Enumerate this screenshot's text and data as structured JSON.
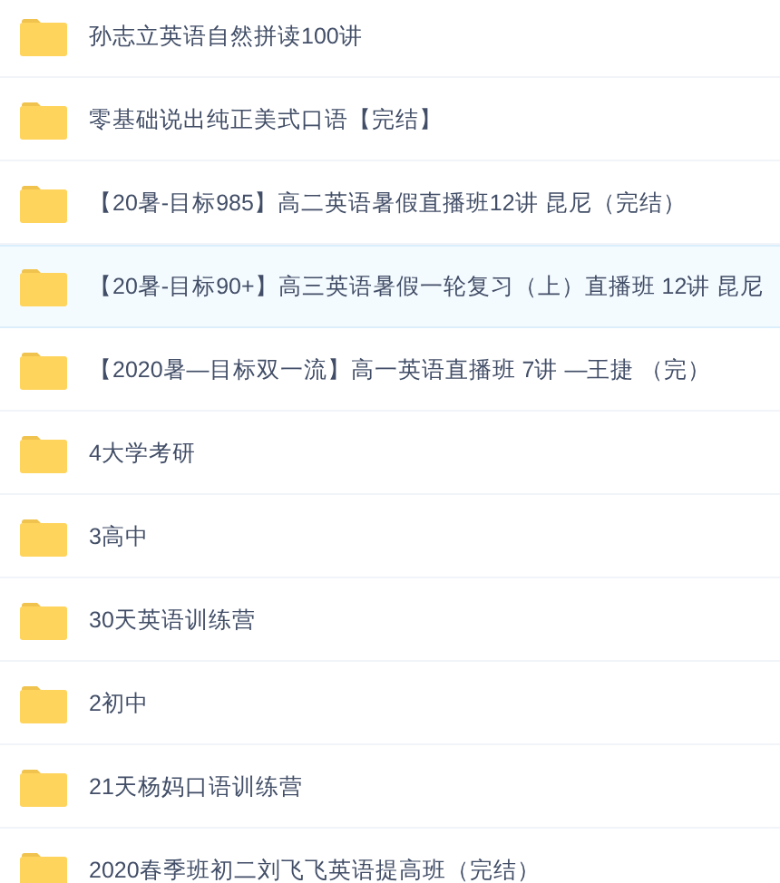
{
  "folders": [
    {
      "name": "孙志立英语自然拼读100讲",
      "selected": false
    },
    {
      "name": "零基础说出纯正美式口语【完结】",
      "selected": false
    },
    {
      "name": "【20暑-目标985】高二英语暑假直播班12讲 昆尼（完结）",
      "selected": false
    },
    {
      "name": "【20暑-目标90+】高三英语暑假一轮复习（上）直播班 12讲 昆尼",
      "selected": true
    },
    {
      "name": "【2020暑—目标双一流】高一英语直播班 7讲 —王捷 （完）",
      "selected": false
    },
    {
      "name": "4大学考研",
      "selected": false
    },
    {
      "name": "3高中",
      "selected": false
    },
    {
      "name": "30天英语训练营",
      "selected": false
    },
    {
      "name": "2初中",
      "selected": false
    },
    {
      "name": "21天杨妈口语训练营",
      "selected": false
    },
    {
      "name": "2020春季班初二刘飞飞英语提高班（完结）",
      "selected": false
    }
  ]
}
